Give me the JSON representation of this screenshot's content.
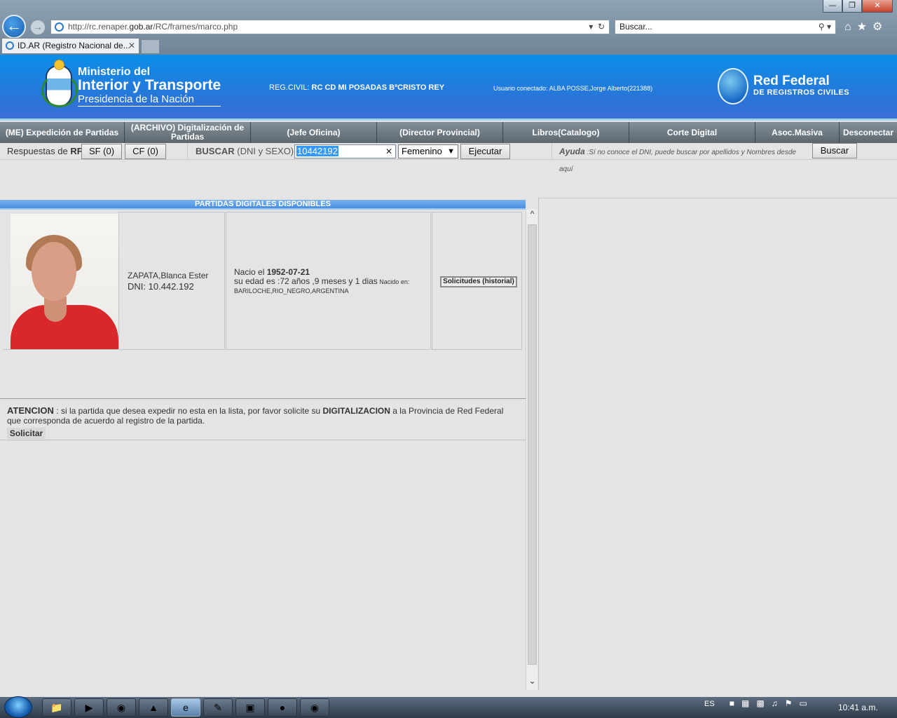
{
  "browser": {
    "url_prefix": "http://rc.renaper.",
    "url_host": "gob.ar",
    "url_path": "/RC/frames/marco.php",
    "search_placeholder": "Buscar...",
    "tab_title": "ID.AR (Registro Nacional de...",
    "window_buttons": [
      "—",
      "❐",
      "✕"
    ]
  },
  "header": {
    "ministry_line1": "Ministerio del",
    "ministry_line2": "Interior y Transporte",
    "ministry_line3": "Presidencia de la Nación",
    "regcivil_label": "REG.CIVIL:",
    "regcivil_value": "RC CD MI POSADAS BºCRISTO REY",
    "user_label": "Usuario conectado:",
    "user_value": "ALBA POSSE,Jorge Alberto(221388)",
    "red_federal_title": "Red Federal",
    "red_federal_subtitle": "DE REGISTROS CIVILES"
  },
  "nav": {
    "items": [
      {
        "label": "(ME) Expedición de Partidas"
      },
      {
        "label": "(ARCHIVO) Digitalización de Partidas"
      },
      {
        "label": "(Jefe Oficina)"
      },
      {
        "label": "(Director Provincial)"
      },
      {
        "label": "Libros(Catalogo)"
      },
      {
        "label": "Corte Digital"
      },
      {
        "label": "Asoc.Masiva"
      },
      {
        "label": "Desconectar"
      }
    ]
  },
  "searchbar": {
    "respuestas_label": "Respuestas de ",
    "respuestas_bold": "RF",
    "sf_button": "SF (0)",
    "cf_button": "CF (0)",
    "buscar_bold": "BUSCAR",
    "buscar_hint": " (DNI y SEXO)",
    "dni_value": "10442192",
    "sexo_value": "Femenino",
    "ejecutar_button": "Ejecutar",
    "ayuda_bold": "Ayuda",
    "ayuda_text": " :Sí no conoce el DNI, puede buscar por apellidos y Nombres desde aquí",
    "buscar_button": "Buscar"
  },
  "panel": {
    "title": "PARTIDAS DIGITALES DISPONIBLES",
    "person_name": "ZAPATA,Blanca Ester",
    "person_dni_label": "DNI: ",
    "person_dni": "10.442.192",
    "birth_label": "Nacio el ",
    "birth_date": "1952-07-21",
    "age_text": "su edad es :72 años ,9 meses y 1 dias",
    "born_in_label": " Nacido en: ",
    "born_in": "BARILOCHE,RIO_NEGRO,ARGENTINA",
    "solicitudes_button": "Solicitudes (historial)"
  },
  "attention": {
    "title": "ATENCION",
    "text1": " : si la partida que desea expedir no esta en la lista, por favor solicite su ",
    "bold_word": "DIGITALIZACION",
    "text2": " a la Provincia de Red Federal que corresponda de acuerdo al registro de la partida.",
    "solicitar_button": "Solicitar"
  },
  "taskbar": {
    "language": "ES",
    "clock": "10:41 a.m."
  }
}
